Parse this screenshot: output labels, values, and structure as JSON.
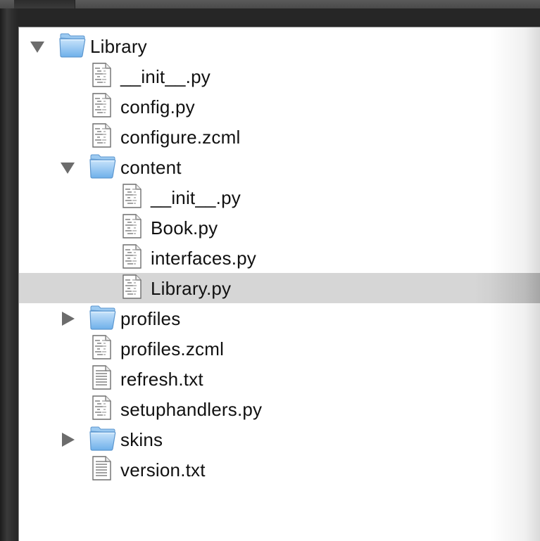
{
  "tree": {
    "items": [
      {
        "label": "Library",
        "type": "folder",
        "level": 0,
        "expanded": true,
        "selected": false
      },
      {
        "label": "__init__.py",
        "type": "file",
        "level": 1,
        "expanded": null,
        "selected": false
      },
      {
        "label": "config.py",
        "type": "file",
        "level": 1,
        "expanded": null,
        "selected": false
      },
      {
        "label": "configure.zcml",
        "type": "file",
        "level": 1,
        "expanded": null,
        "selected": false
      },
      {
        "label": "content",
        "type": "folder",
        "level": 1,
        "expanded": true,
        "selected": false
      },
      {
        "label": "__init__.py",
        "type": "file",
        "level": 2,
        "expanded": null,
        "selected": false
      },
      {
        "label": "Book.py",
        "type": "file",
        "level": 2,
        "expanded": null,
        "selected": false
      },
      {
        "label": "interfaces.py",
        "type": "file",
        "level": 2,
        "expanded": null,
        "selected": false
      },
      {
        "label": "Library.py",
        "type": "file",
        "level": 2,
        "expanded": null,
        "selected": true
      },
      {
        "label": "profiles",
        "type": "folder",
        "level": 1,
        "expanded": false,
        "selected": false
      },
      {
        "label": "profiles.zcml",
        "type": "file",
        "level": 1,
        "expanded": null,
        "selected": false
      },
      {
        "label": "refresh.txt",
        "type": "text-file",
        "level": 1,
        "expanded": null,
        "selected": false
      },
      {
        "label": "setuphandlers.py",
        "type": "file",
        "level": 1,
        "expanded": null,
        "selected": false
      },
      {
        "label": "skins",
        "type": "folder",
        "level": 1,
        "expanded": false,
        "selected": false
      },
      {
        "label": "version.txt",
        "type": "text-file",
        "level": 1,
        "expanded": null,
        "selected": false
      }
    ]
  },
  "icons": {
    "folder": "folder-icon",
    "file": "python-file-icon",
    "text-file": "text-file-icon",
    "expanded": "disclosure-triangle-down-icon",
    "collapsed": "disclosure-triangle-right-icon"
  },
  "colors": {
    "panel_background": "#ffffff",
    "selection": "#d6d6d6",
    "text": "#111111",
    "folder_blue": "#8fc3f0",
    "window_chrome": "#2b2b2b"
  }
}
